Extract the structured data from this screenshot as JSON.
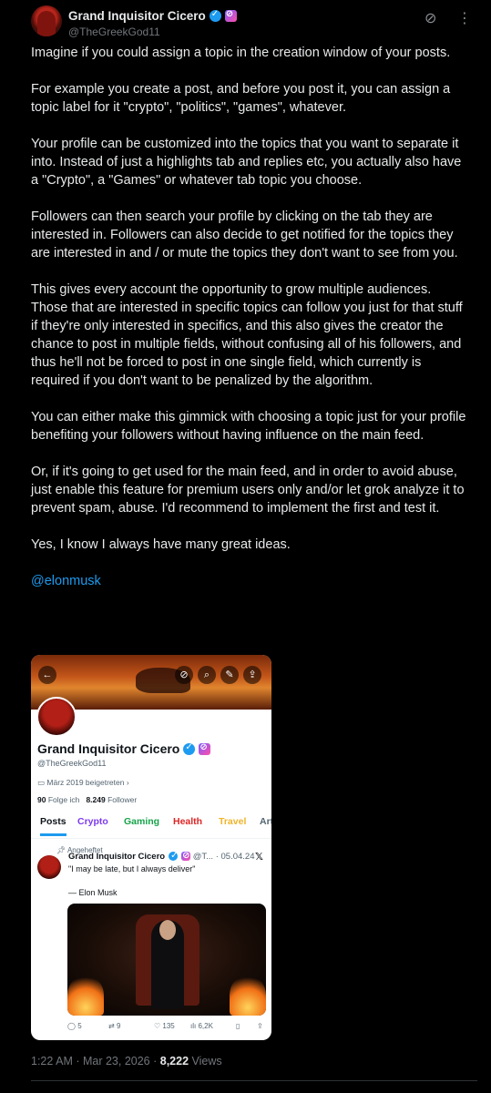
{
  "author": {
    "name": "Grand Inquisitor Cicero",
    "handle": "@TheGreekGod11"
  },
  "post": {
    "paragraphs": [
      "Imagine if you could assign a topic in the creation window of your posts.",
      "For example you create a post, and before you post it, you can assign a topic label for it \"crypto\", \"politics\", \"games\", whatever.",
      "Your profile can be customized into the topics that you want to separate it into. Instead of just a highlights tab and replies etc, you actually also have a \"Crypto\", a \"Games\" or whatever tab topic you choose.",
      "Followers can then search your profile by clicking on the tab they are interested in. Followers can also decide to get notified for the topics they are interested in and / or mute the topics they don't want to see from you.",
      "This gives every account the opportunity to grow multiple audiences. Those that are interested in specific topics can follow you just for that stuff if they're only interested in specifics, and this also gives the creator the chance to post in multiple fields, without confusing all of his followers, and thus he'll not be forced to post in one single field, which currently is required if you don't want to be penalized by the algorithm.",
      "You can either make this gimmick with choosing a topic just for your profile benefiting your followers without having influence on the main feed.",
      "Or, if it's going to get used for the main feed, and in order to avoid abuse, just enable this feature for premium users only and/or let grok analyze it to prevent spam, abuse. I'd recommend to implement the first and test it.",
      "Yes, I know I always have many great ideas."
    ],
    "mention": "@elonmusk"
  },
  "screenshot": {
    "name": "Grand Inquisitor Cicero",
    "handle": "@TheGreekGod11",
    "joined": "März 2019 beigetreten",
    "following_count": "90",
    "following_label": "Folge ich",
    "followers_count": "8.249",
    "followers_label": "Follower",
    "tabs": [
      {
        "label": "Posts",
        "color": "#0f1419"
      },
      {
        "label": "Crypto",
        "color": "#7c3aed"
      },
      {
        "label": "Gaming",
        "color": "#16a34a"
      },
      {
        "label": "Health",
        "color": "#dc2626"
      },
      {
        "label": "Travel",
        "color": "#f0b429"
      },
      {
        "label": "Art",
        "color": "#536471"
      }
    ],
    "pinned_label": "Angeheftet",
    "pinned_name": "Grand Inquisitor Cicero",
    "pinned_meta": "@T... · 05.04.24",
    "pinned_quote": "\"I may be late, but I always deliver\"",
    "pinned_attribution": "— Elon Musk",
    "stats": {
      "replies": "5",
      "reposts": "9",
      "likes": "135",
      "views": "6,2K"
    }
  },
  "footer": {
    "timestamp": "1:22 AM · Mar 23, 2026 · ",
    "views_count": "8,222",
    "views_label": " Views"
  },
  "icons": [
    "grok-logo-icon",
    "more-icon",
    "back-icon",
    "search-icon",
    "edit-icon",
    "share-icon",
    "reply-icon",
    "repost-icon",
    "like-icon",
    "views-icon",
    "bookmark-icon",
    "pin-icon",
    "calendar-icon",
    "x-logo-icon"
  ]
}
